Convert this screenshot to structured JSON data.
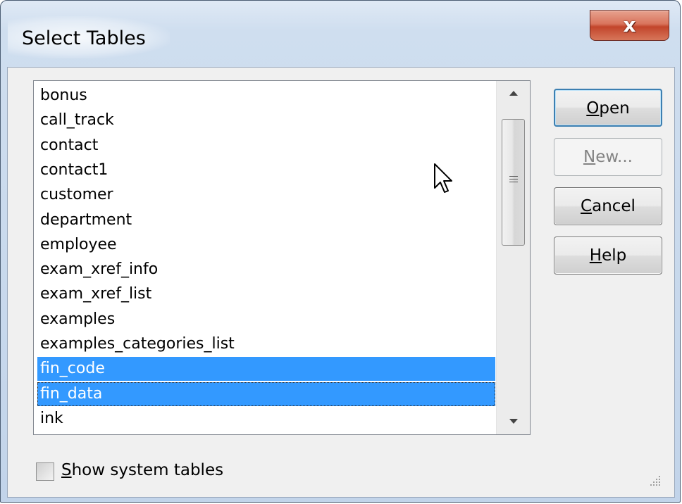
{
  "window": {
    "title": "Select Tables",
    "close_glyph": "x"
  },
  "tables_list": {
    "items": [
      {
        "label": "bonus",
        "selected": false
      },
      {
        "label": "call_track",
        "selected": false
      },
      {
        "label": "contact",
        "selected": false
      },
      {
        "label": "contact1",
        "selected": false
      },
      {
        "label": "customer",
        "selected": false
      },
      {
        "label": "department",
        "selected": false
      },
      {
        "label": "employee",
        "selected": false
      },
      {
        "label": "exam_xref_info",
        "selected": false
      },
      {
        "label": "exam_xref_list",
        "selected": false
      },
      {
        "label": "examples",
        "selected": false
      },
      {
        "label": "examples_categories_list",
        "selected": false
      },
      {
        "label": "fin_code",
        "selected": true
      },
      {
        "label": "fin_data",
        "selected": true,
        "focused": true
      },
      {
        "label": "ink",
        "selected": false
      }
    ]
  },
  "buttons": {
    "open": {
      "accel": "O",
      "rest": "pen",
      "enabled": true,
      "default": true
    },
    "new": {
      "accel": "N",
      "rest": "ew...",
      "enabled": false
    },
    "cancel": {
      "accel": "C",
      "rest": "ancel",
      "enabled": true
    },
    "help": {
      "accel": "H",
      "rest": "elp",
      "enabled": true
    }
  },
  "show_system_tables": {
    "accel": "S",
    "rest": "how system tables",
    "checked": false
  },
  "colors": {
    "selection": "#3399ff",
    "close_button": "#c2452b",
    "dialog_face": "#f0f0f0"
  },
  "icons": [
    "close-icon",
    "scroll-up-arrow-icon",
    "scroll-down-arrow-icon",
    "mouse-pointer-icon",
    "size-grip-icon"
  ]
}
